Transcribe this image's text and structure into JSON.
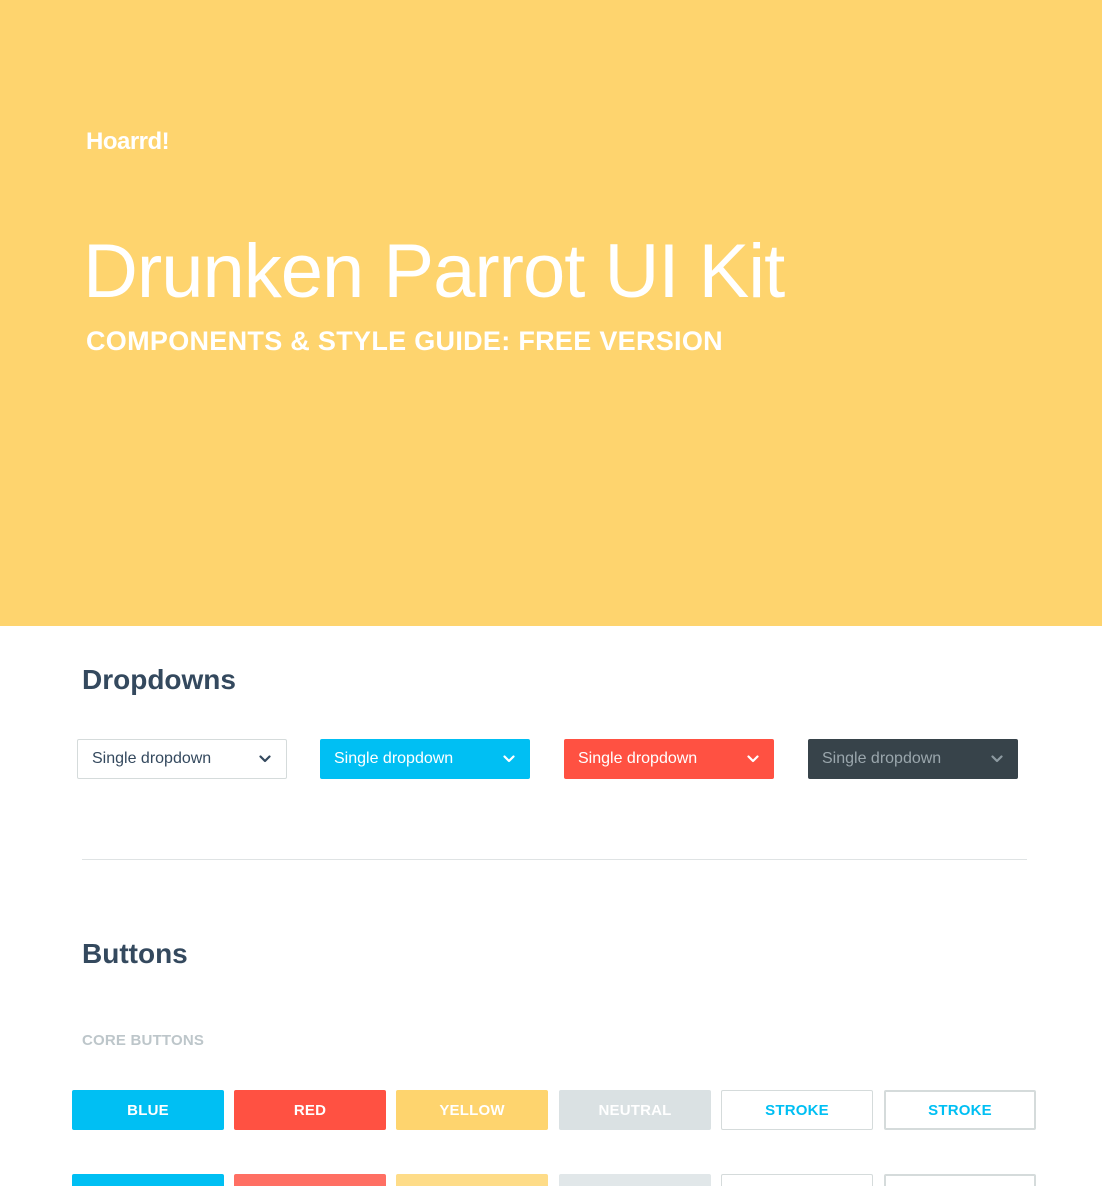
{
  "hero": {
    "logo": "Hoarrd!",
    "title": "Drunken Parrot UI Kit",
    "subtitle": "COMPONENTS & STYLE GUIDE: FREE VERSION",
    "background": "#fed46e"
  },
  "dropdowns": {
    "heading": "Dropdowns",
    "items": [
      {
        "label": "Single dropdown",
        "variant": "default",
        "icon": "chevron-down-icon"
      },
      {
        "label": "Single dropdown",
        "variant": "blue",
        "color": "#00bff3",
        "icon": "chevron-down-icon"
      },
      {
        "label": "Single dropdown",
        "variant": "red",
        "color": "#ff5142",
        "icon": "chevron-down-icon"
      },
      {
        "label": "Single dropdown",
        "variant": "dark",
        "color": "#37434a",
        "icon": "chevron-down-icon"
      }
    ]
  },
  "buttons": {
    "heading": "Buttons",
    "subheading": "CORE BUTTONS",
    "row1": [
      {
        "label": "BLUE",
        "color": "#00bff3"
      },
      {
        "label": "RED",
        "color": "#ff5142"
      },
      {
        "label": "YELLOW",
        "color": "#fed46e"
      },
      {
        "label": "NEUTRAL",
        "color": "#dae1e3"
      },
      {
        "label": "STROKE",
        "color": "#ffffff"
      },
      {
        "label": "STROKE",
        "color": "#ffffff"
      }
    ],
    "row2": [
      {
        "label": "",
        "color": "#00bff3"
      },
      {
        "label": "",
        "color": "#ff6f63"
      },
      {
        "label": "",
        "color": "#fedc88"
      },
      {
        "label": "",
        "color": "#e1e7e9"
      },
      {
        "label": "",
        "color": "#ffffff"
      },
      {
        "label": "",
        "color": "#ffffff"
      }
    ]
  }
}
